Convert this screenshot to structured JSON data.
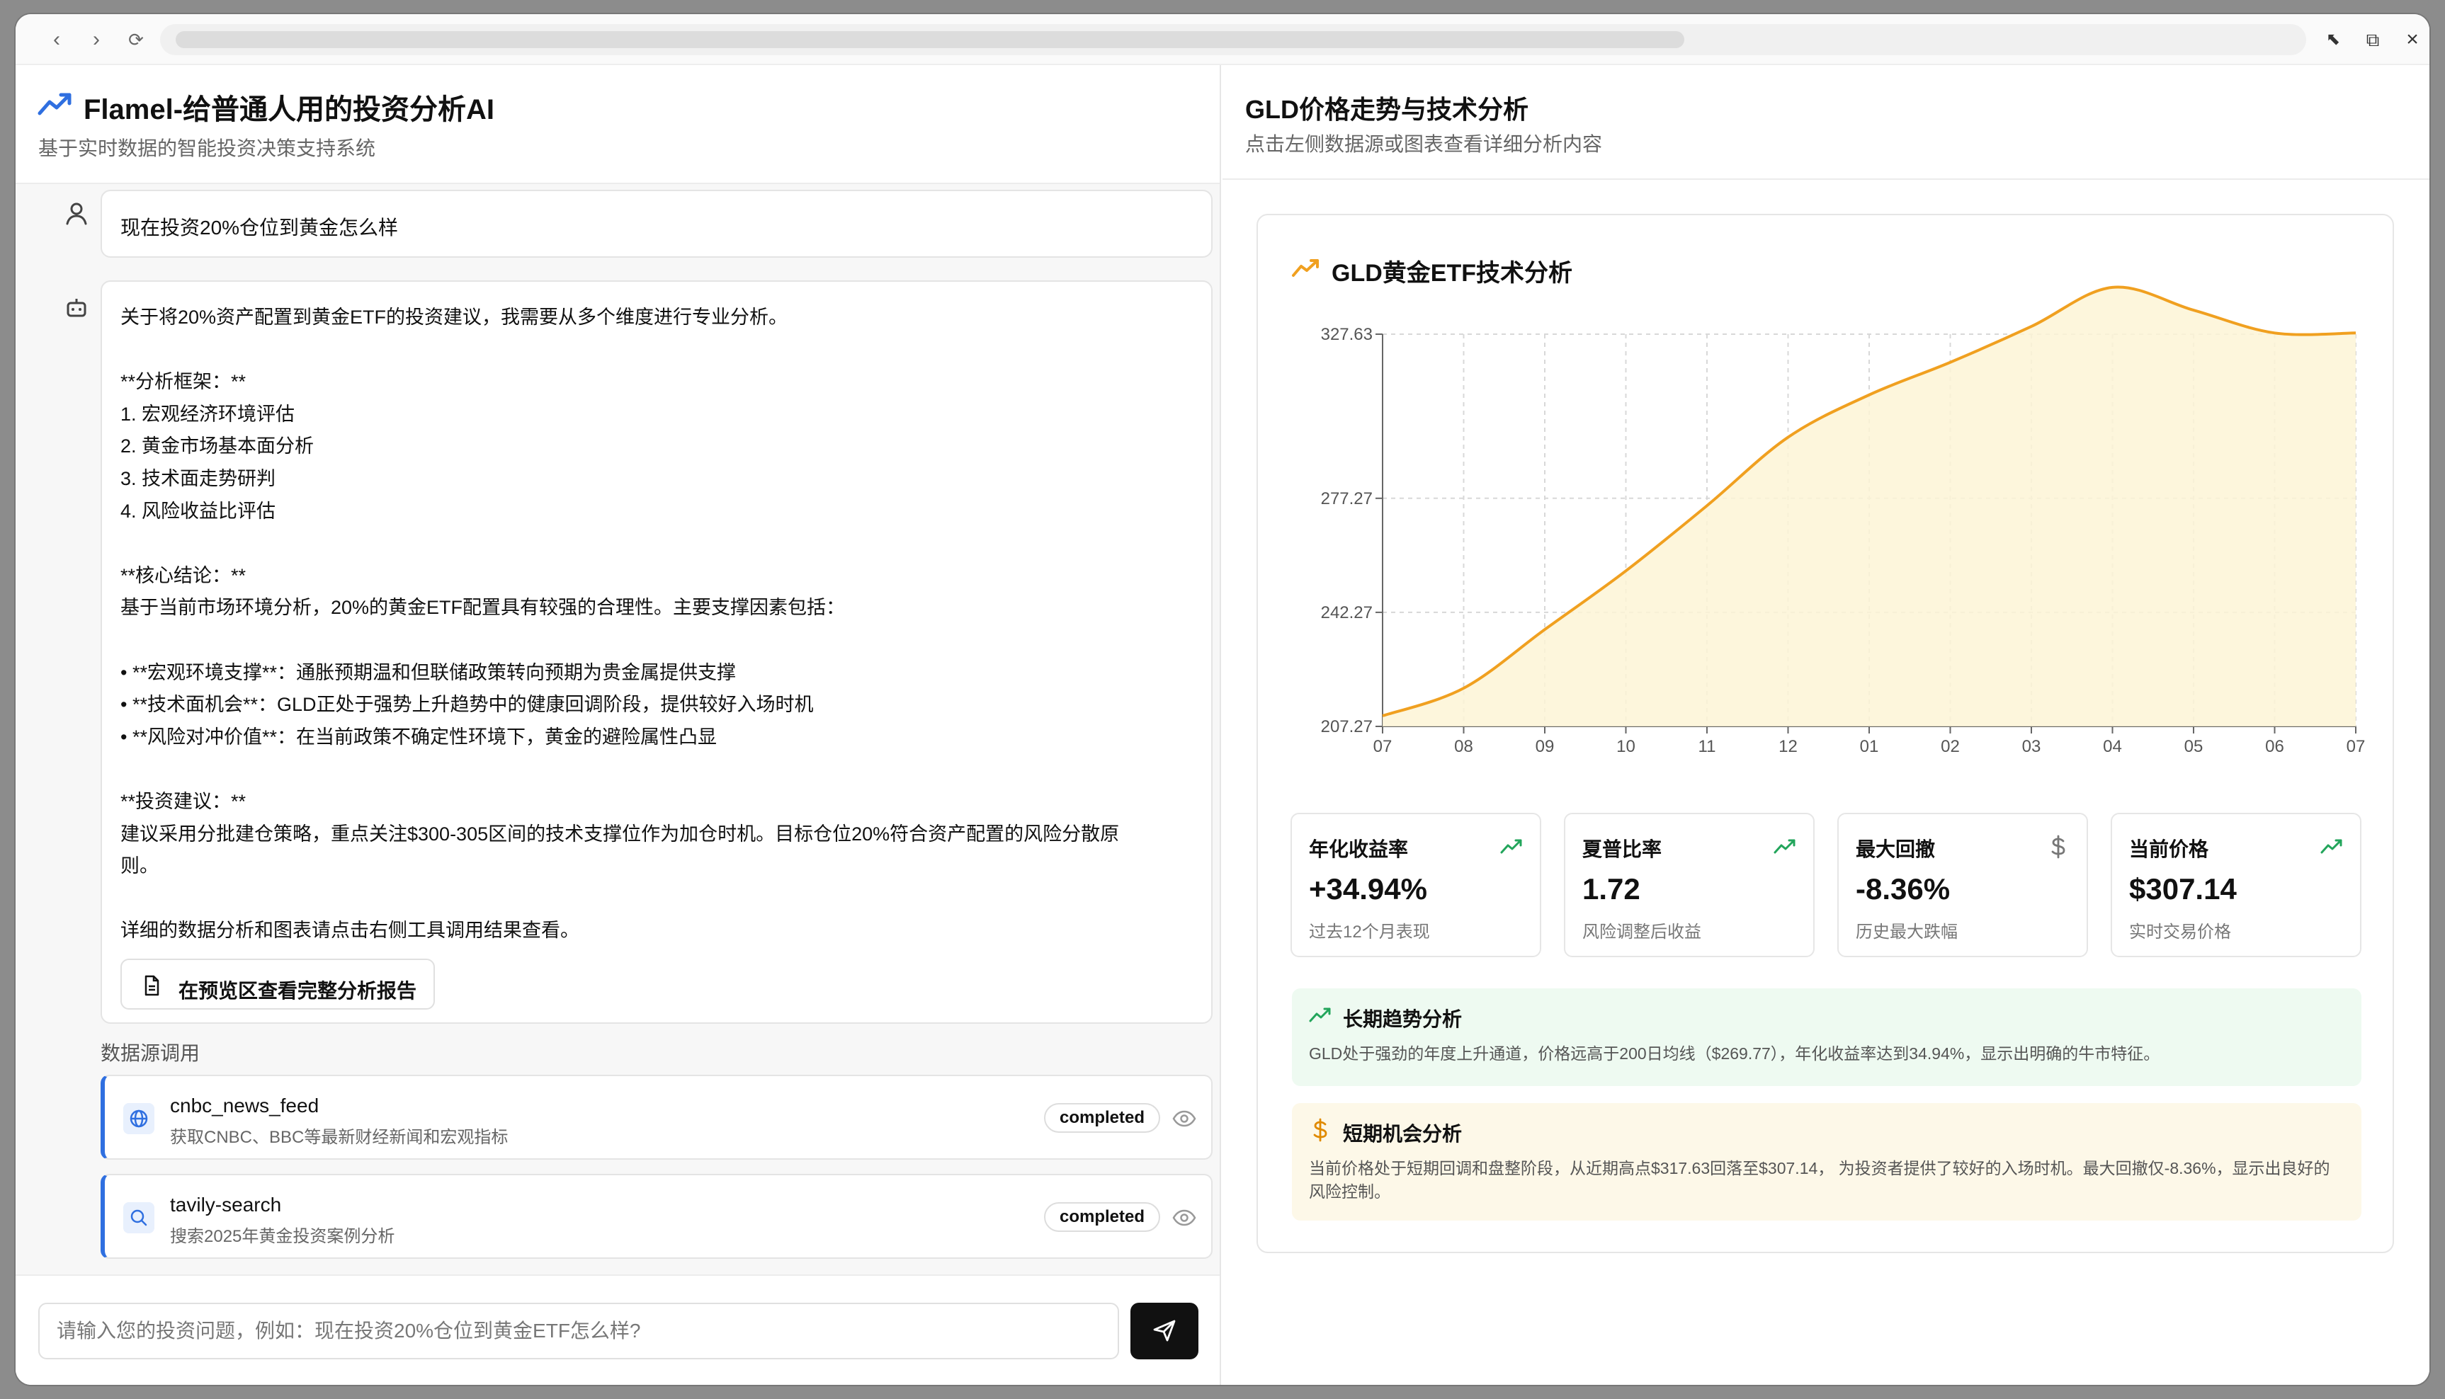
{
  "app": {
    "title": "Flamel-给普通人用的投资分析AI",
    "subtitle": "基于实时数据的智能投资决策支持系统"
  },
  "chat": {
    "user_message": "现在投资20%仓位到黄金怎么样",
    "assistant_lines": [
      "关于将20%资产配置到黄金ETF的投资建议，我需要从多个维度进行专业分析。",
      "",
      "**分析框架：**",
      "1. 宏观经济环境评估",
      "2. 黄金市场基本面分析",
      "3. 技术面走势研判",
      "4. 风险收益比评估",
      "",
      "**核心结论：**",
      "基于当前市场环境分析，20%的黄金ETF配置具有较强的合理性。主要支撑因素包括：",
      "",
      "• **宏观环境支撑**：通胀预期温和但联储政策转向预期为贵金属提供支撑",
      "• **技术面机会**：GLD正处于强势上升趋势中的健康回调阶段，提供较好入场时机",
      "• **风险对冲价值**：在当前政策不确定性环境下，黄金的避险属性凸显",
      "",
      "**投资建议：**",
      "建议采用分批建仓策略，重点关注$300-305区间的技术支撑位作为加仓时机。目标仓位20%符合资产配置的风险分散原",
      "则。",
      "",
      "详细的数据分析和图表请点击右侧工具调用结果查看。"
    ],
    "report_button": "在预览区查看完整分析报告",
    "datasource_title": "数据源调用",
    "tools": [
      {
        "name": "cnbc_news_feed",
        "desc": "获取CNBC、BBC等最新财经新闻和宏观指标",
        "status": "completed",
        "icon": "globe-icon"
      },
      {
        "name": "tavily-search",
        "desc": "搜索2025年黄金投资案例分析",
        "status": "completed",
        "icon": "search-icon"
      }
    ],
    "input_placeholder": "请输入您的投资问题，例如：现在投资20%仓位到黄金ETF怎么样?"
  },
  "preview": {
    "title": "GLD价格走势与技术分析",
    "subtitle": "点击左侧数据源或图表查看详细分析内容",
    "card_title": "GLD黄金ETF技术分析",
    "kpis": [
      {
        "label": "年化收益率",
        "value": "+34.94%",
        "desc": "过去12个月表现",
        "icon": "trend-up-icon"
      },
      {
        "label": "夏普比率",
        "value": "1.72",
        "desc": "风险调整后收益",
        "icon": "trend-up-icon"
      },
      {
        "label": "最大回撤",
        "value": "-8.36%",
        "desc": "历史最大跌幅",
        "icon": "dollar-icon"
      },
      {
        "label": "当前价格",
        "value": "$307.14",
        "desc": "实时交易价格",
        "icon": "trend-up-icon"
      }
    ],
    "long_term": {
      "title": "长期趋势分析",
      "text": "GLD处于强劲的年度上升通道，价格远高于200日均线（$269.77），年化收益率达到34.94%，显示出明确的牛市特征。"
    },
    "short_term": {
      "title": "短期机会分析",
      "text": "当前价格处于短期回调和盘整阶段，从近期高点$317.63回落至$307.14，  为投资者提供了较好的入场时机。最大回撤仅-8.36%，显示出良好的风险控制。"
    }
  },
  "colors": {
    "accent_blue": "#2f6fe0",
    "line_orange": "#f0a020",
    "area_fill": "#fdf5d6",
    "trend_green": "#22a55b",
    "dollar_orange": "#e08a00"
  },
  "chart_data": {
    "type": "area",
    "x": [
      "07",
      "08",
      "09",
      "10",
      "11",
      "12",
      "01",
      "02",
      "03",
      "04",
      "05",
      "06",
      "07"
    ],
    "series": [
      {
        "values": [
          210.5,
          219,
          237,
          255,
          275,
          296,
          309,
          319,
          330,
          342,
          335,
          328,
          328
        ]
      }
    ],
    "yticks": [
      207.27,
      242.27,
      277.27,
      327.63
    ],
    "ylim": [
      207.27,
      327.63
    ],
    "grid": true
  }
}
